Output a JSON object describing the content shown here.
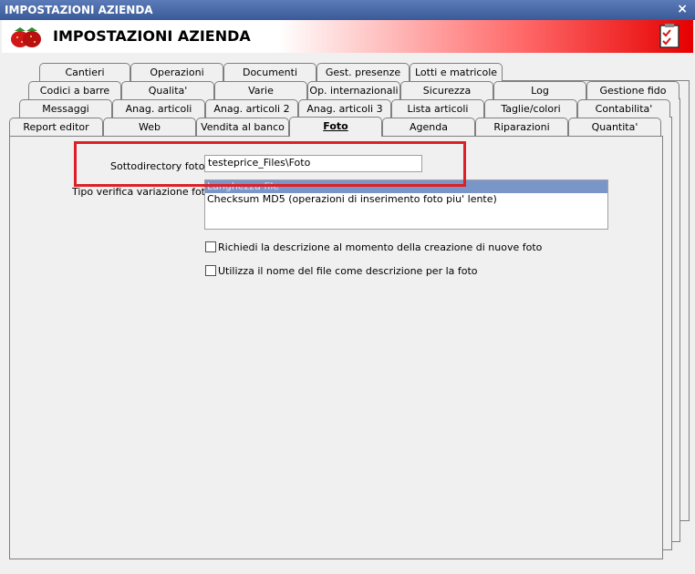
{
  "window": {
    "title": "IMPOSTAZIONI AZIENDA",
    "close": "×"
  },
  "header": {
    "title": "IMPOSTAZIONI AZIENDA",
    "logo_icon": "strawberries-icon",
    "check_icon": "checklist-icon",
    "accent": "#e60000"
  },
  "tabs": {
    "row1": [
      "Cantieri",
      "Operazioni",
      "Documenti",
      "Gest. presenze",
      "Lotti e matricole"
    ],
    "row2": [
      "Codici a barre",
      "Qualita'",
      "Varie",
      "Op. internazionali",
      "Sicurezza",
      "Log",
      "Gestione fido"
    ],
    "row3": [
      "Messaggi",
      "Anag. articoli",
      "Anag. articoli 2",
      "Anag. articoli 3",
      "Lista articoli",
      "Taglie/colori",
      "Contabilita'"
    ],
    "row4": [
      "Report editor",
      "Web",
      "Vendita al banco",
      "Foto",
      "Agenda",
      "Riparazioni",
      "Quantita'"
    ]
  },
  "foto": {
    "subdir_label": "Sottodirectory foto :",
    "subdir_value": "testeprice_Files\\Foto",
    "verify_label": "Tipo verifica variazione foto :",
    "verify_options": [
      "Lunghezza file",
      "Checksum MD5 (operazioni di inserimento foto piu' lente)"
    ],
    "checkbox1_label": "Richiedi la descrizione al momento della creazione di nuove foto",
    "checkbox2_label": "Utilizza il nome del file come descrizione per la foto"
  }
}
